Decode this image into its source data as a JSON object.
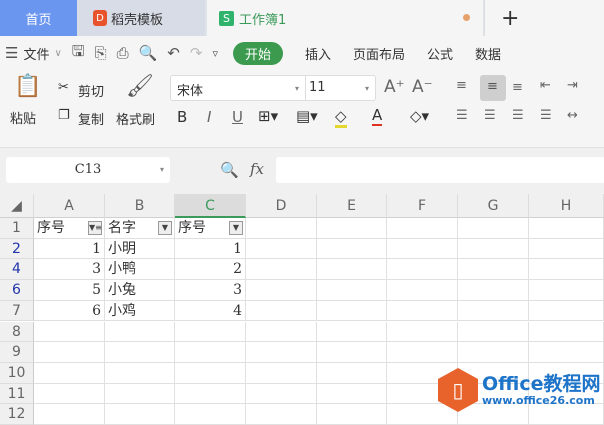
{
  "tabs": {
    "home": "首页",
    "docer": "稻壳模板",
    "workbook": "工作簿1",
    "new": "+",
    "docer_icon": "D",
    "sheet_icon": "S"
  },
  "menu": {
    "file": "文件",
    "start": "开始",
    "insert": "插入",
    "layout": "页面布局",
    "formula": "公式",
    "data": "数据"
  },
  "ribbon": {
    "paste": "粘贴",
    "cut": "剪切",
    "copy": "复制",
    "format_painter": "格式刷",
    "font": "宋体",
    "size": "11",
    "bold": "B",
    "italic": "I",
    "underline": "U"
  },
  "formula_bar": {
    "name_box": "C13",
    "fx": "fx",
    "value": ""
  },
  "columns": [
    "A",
    "B",
    "C",
    "D",
    "E",
    "F",
    "G",
    "H"
  ],
  "rows": [
    {
      "num": "1",
      "filtered": false,
      "cells": [
        "序号",
        "名字",
        "序号"
      ]
    },
    {
      "num": "2",
      "filtered": true,
      "cells": [
        "1",
        "小明",
        "1"
      ]
    },
    {
      "num": "4",
      "filtered": true,
      "cells": [
        "3",
        "小鸭",
        "2"
      ]
    },
    {
      "num": "6",
      "filtered": true,
      "cells": [
        "5",
        "小兔",
        "3"
      ]
    },
    {
      "num": "7",
      "filtered": false,
      "cells": [
        "6",
        "小鸡",
        "4"
      ]
    },
    {
      "num": "8",
      "filtered": false,
      "cells": [
        "",
        "",
        ""
      ]
    },
    {
      "num": "9",
      "filtered": false,
      "cells": [
        "",
        "",
        ""
      ]
    },
    {
      "num": "10",
      "filtered": false,
      "cells": [
        "",
        "",
        ""
      ]
    },
    {
      "num": "11",
      "filtered": false,
      "cells": [
        "",
        "",
        ""
      ]
    },
    {
      "num": "12",
      "filtered": false,
      "cells": [
        "",
        "",
        ""
      ]
    }
  ],
  "watermark": {
    "title": "Office教程网",
    "url": "www.office26.com"
  }
}
